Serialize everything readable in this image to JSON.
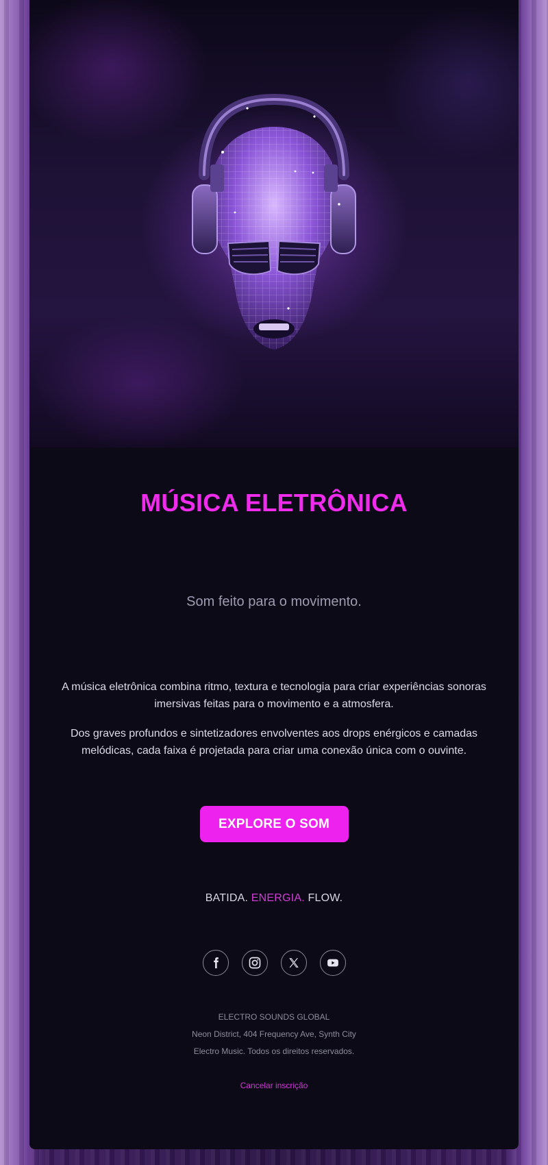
{
  "hero": {
    "image_name": "disco-ball-skull-with-headphones"
  },
  "title": "MÚSICA ELETRÔNICA",
  "subtitle": "Som feito para o movimento.",
  "paragraphs": [
    "A música eletrônica combina ritmo, textura e tecnologia para criar experiências sonoras imersivas feitas para o movimento e a atmosfera.",
    "Dos graves profundos e sintetizadores envolventes aos drops enérgicos e camadas melódicas, cada faixa é projetada para criar uma conexão única com o ouvinte."
  ],
  "cta": {
    "label": "EXPLORE O SOM"
  },
  "tagline": {
    "part1": "BATIDA.",
    "part2": "ENERGIA.",
    "part3": "FLOW."
  },
  "social": [
    {
      "icon": "facebook-icon"
    },
    {
      "icon": "instagram-icon"
    },
    {
      "icon": "x-icon"
    },
    {
      "icon": "youtube-icon"
    }
  ],
  "footer": {
    "company": "ELECTRO SOUNDS GLOBAL",
    "address": "Neon District, 404 Frequency Ave, Synth City",
    "copyright": "Electro Music. Todos os direitos reservados.",
    "unsubscribe": "Cancelar inscrição"
  },
  "colors": {
    "accent": "#ee22ee",
    "background": "#0c0a17"
  }
}
